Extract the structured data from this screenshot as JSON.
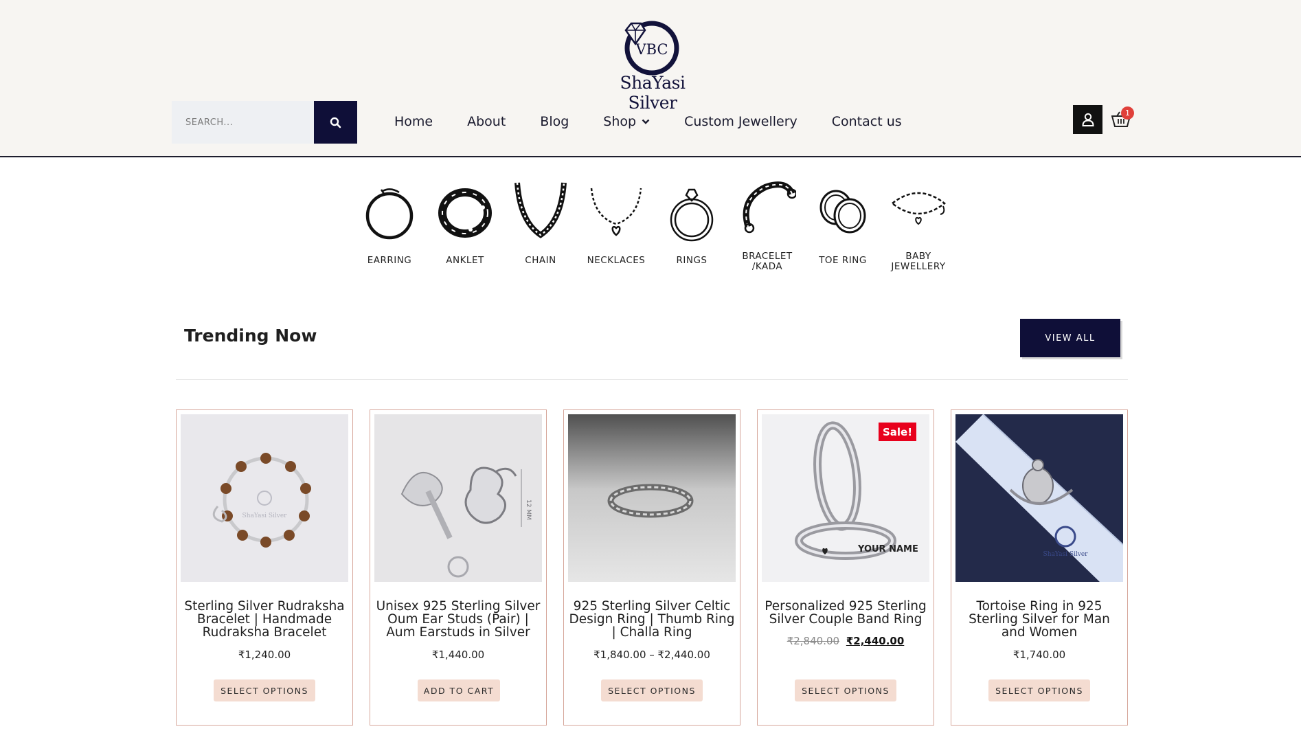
{
  "header": {
    "logo": {
      "monogram": "VBC",
      "brand": "ShaYasi Silver"
    },
    "search": {
      "placeholder": "SEARCH..."
    },
    "nav": [
      {
        "label": "Home"
      },
      {
        "label": "About"
      },
      {
        "label": "Blog"
      },
      {
        "label": "Shop"
      },
      {
        "label": "Custom Jewellery"
      },
      {
        "label": "Contact us"
      }
    ],
    "cart_count": "1"
  },
  "categories": [
    {
      "label": "EARRING",
      "icon": "earring-icon"
    },
    {
      "label": "ANKLET",
      "icon": "anklet-icon"
    },
    {
      "label": "CHAIN",
      "icon": "chain-icon"
    },
    {
      "label": "NECKLACES",
      "icon": "necklace-icon"
    },
    {
      "label": "RINGS",
      "icon": "ring-icon"
    },
    {
      "label": "BRACELET /KADA",
      "icon": "bracelet-icon"
    },
    {
      "label": "TOE RING",
      "icon": "toe-ring-icon"
    },
    {
      "label": "BABY JEWELLERY",
      "icon": "baby-jewellery-icon"
    }
  ],
  "trending": {
    "title": "Trending Now",
    "view_all": "VIEW ALL",
    "products": [
      {
        "title": "Sterling Silver Rudraksha Bracelet | Handmade Rudraksha Bracelet",
        "price": "₹1,240.00",
        "button": "SELECT OPTIONS"
      },
      {
        "title": "Unisex 925 Sterling Silver Oum Ear Studs (Pair) | Aum Earstuds in Silver",
        "price": "₹1,440.00",
        "button": "ADD TO CART"
      },
      {
        "title": "925 Sterling Silver Celtic Design Ring | Thumb Ring | Challa Ring",
        "price": "₹1,840.00 – ₹2,440.00",
        "button": "SELECT OPTIONS"
      },
      {
        "title": "Personalized 925 Sterling Silver Couple Band Ring",
        "old_price": "₹2,840.00",
        "new_price": "₹2,440.00",
        "badge": "Sale!",
        "button": "SELECT OPTIONS"
      },
      {
        "title": "Tortoise Ring in 925 Sterling Silver for Man and Women",
        "price": "₹1,740.00",
        "button": "SELECT OPTIONS"
      }
    ]
  },
  "image_text": {
    "watermark": "ShaYasi Silver",
    "dimension": "12 MM",
    "engraving": "YOUR NAME"
  },
  "colors": {
    "brand_navy": "#0f0f38",
    "button_peach": "#f4dcd1",
    "card_border": "#d6a69a",
    "sale_red": "#e8001c"
  }
}
